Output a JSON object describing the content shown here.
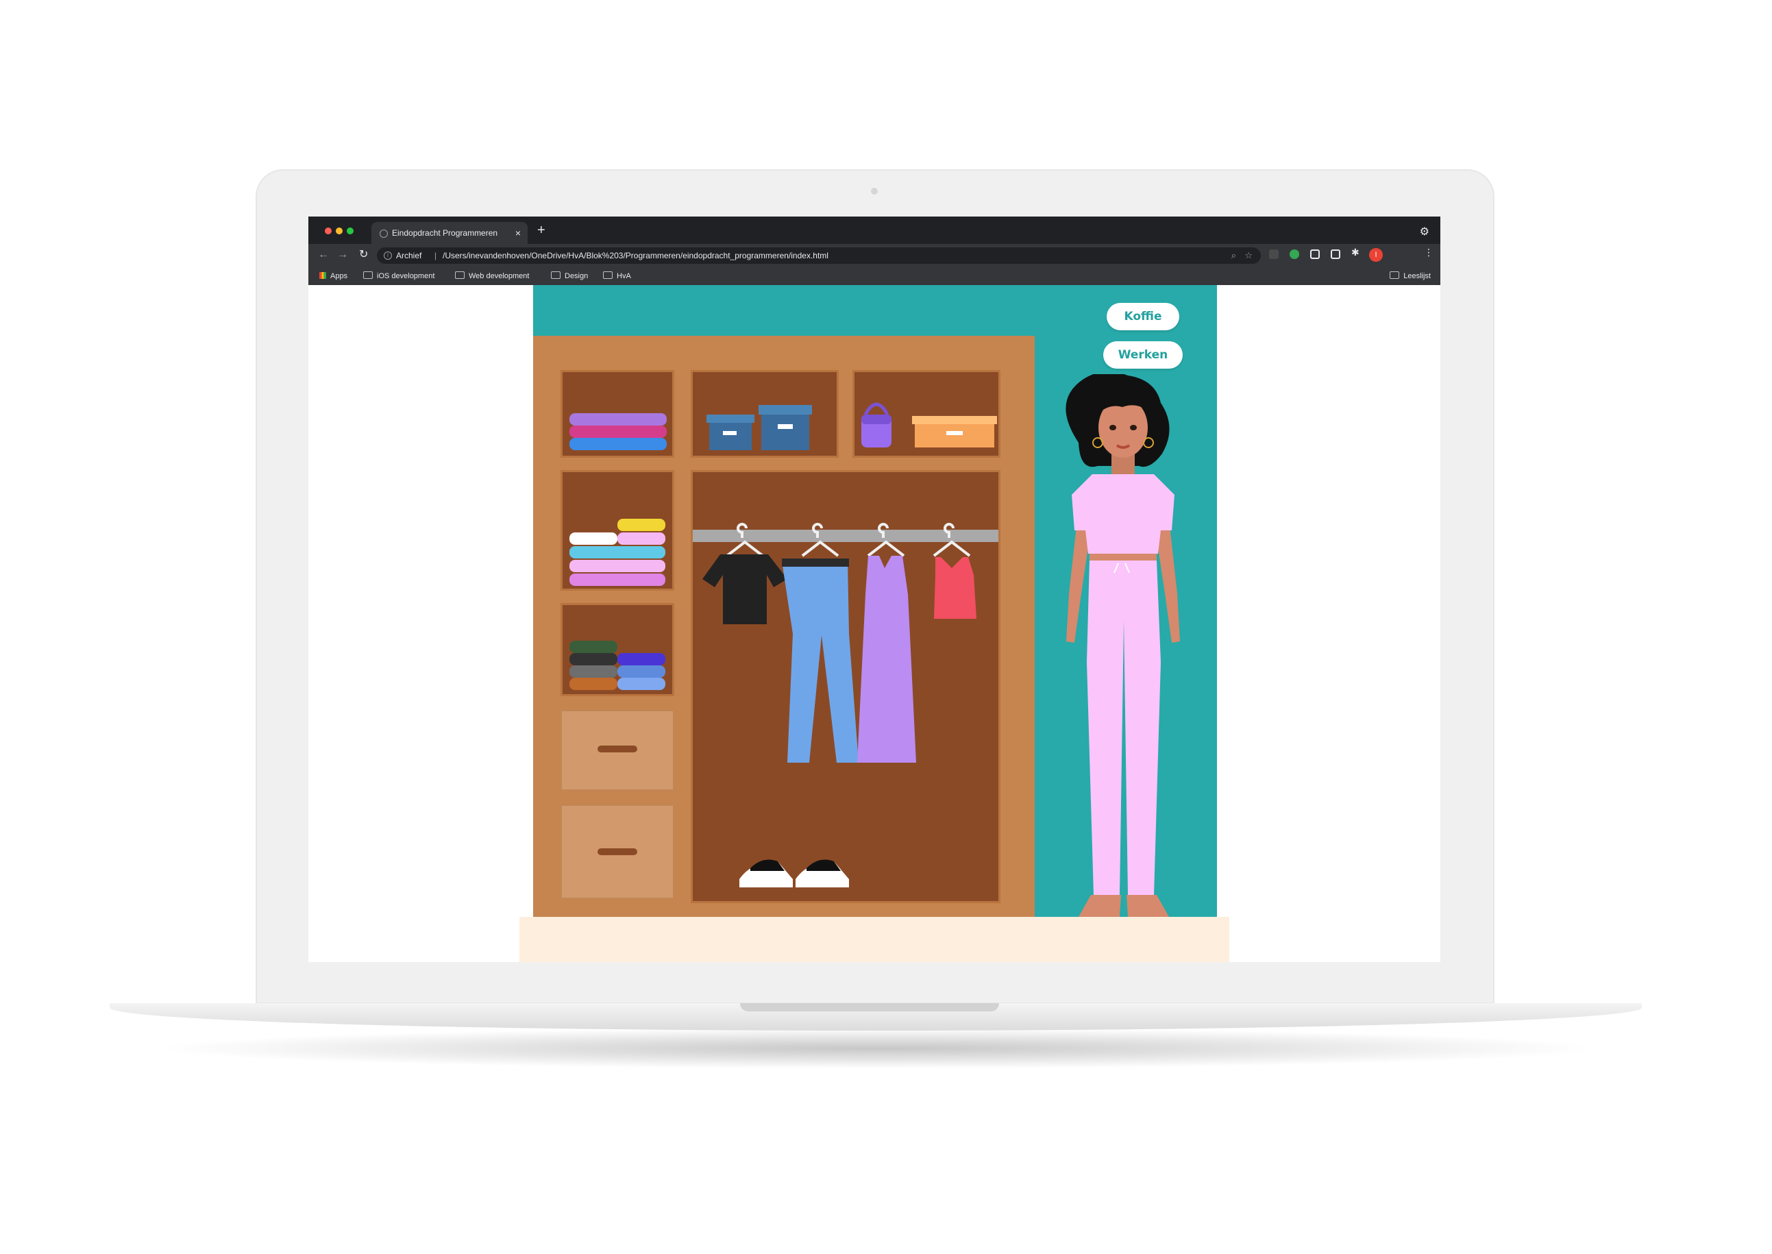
{
  "browser": {
    "tab_title": "Eindopdracht Programmeren",
    "tab_close": "×",
    "new_tab": "+",
    "nav_back": "←",
    "nav_forward": "→",
    "nav_reload": "↻",
    "address": {
      "security_label": "Archief",
      "separator": "|",
      "url": "/Users/inevandenhoven/OneDrive/HvA/Blok%203/Programmeren/eindopdracht_programmeren/index.html"
    },
    "menu_dots": "⋮",
    "profile_initial": "I",
    "bookmarks": [
      "Apps",
      "iOS development",
      "Web development",
      "Design",
      "HvA"
    ],
    "reading_list": "Leeslijst"
  },
  "page": {
    "buttons": {
      "koffie": "Koffie",
      "werken": "Werken"
    }
  },
  "colors": {
    "scene_background": "#27aaa9",
    "wardrobe_frame": "#c6844f",
    "wardrobe_inside": "#8b4a26",
    "floor": "#fdeedd",
    "button_text": "#23a19e",
    "outfit": "#fbc4fb"
  }
}
